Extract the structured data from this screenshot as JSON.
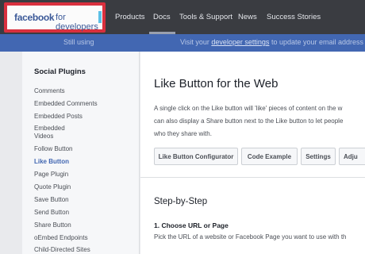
{
  "logo": {
    "brand": "facebook",
    "suffix": "for developers"
  },
  "nav": {
    "items": [
      "Products",
      "Docs",
      "Tools & Support",
      "News",
      "Success Stories"
    ]
  },
  "banner": {
    "prefix": "Still using",
    "middle": "Visit your",
    "link": "developer settings",
    "suffix": "to update your email address a"
  },
  "sidebar": {
    "title": "Social Plugins",
    "items": [
      "Comments",
      "Embedded Comments",
      "Embedded Posts",
      "Embedded",
      "Videos",
      "Follow Button",
      "Like Button",
      "Page Plugin",
      "Quote Plugin",
      "Save Button",
      "Send Button",
      "Share Button",
      "oEmbed Endpoints",
      "Child-Directed Sites"
    ]
  },
  "main": {
    "title": "Like Button for the Web",
    "paragraph": [
      "A single click on the Like button will 'like' pieces of content on the w",
      "can also display a Share button next to the Like button to let people",
      "who they share with."
    ],
    "tabs": [
      "Like Button Configurator",
      "Code Example",
      "Settings",
      "Adju"
    ],
    "section_title": "Step-by-Step",
    "step_title": "1. Choose URL or Page",
    "step_desc": "Pick the URL of a website or Facebook Page you want to use with th"
  }
}
